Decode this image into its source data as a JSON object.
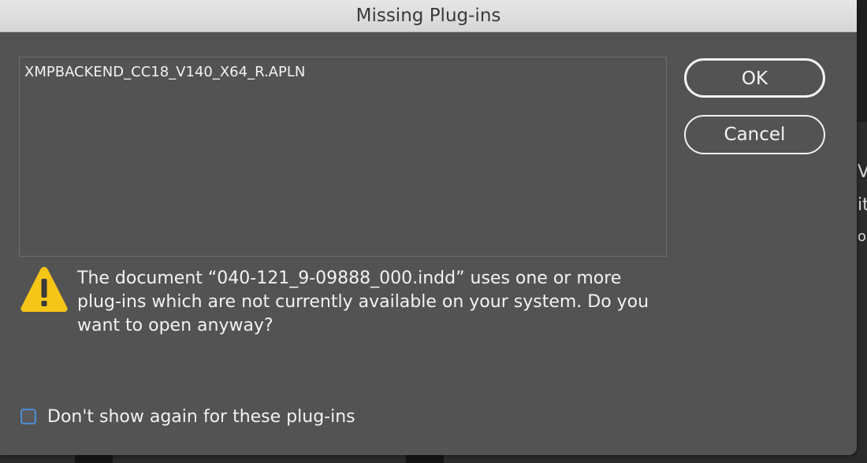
{
  "dialog": {
    "title": "Missing Plug-ins",
    "plugins": [
      "XMPBACKEND_CC18_V140_X64_R.APLN"
    ],
    "message": "The document “040-121_9-09888_000.indd” uses one or more plug-ins which are not currently available on your system. Do you want to open anyway?",
    "buttons": {
      "ok_label": "OK",
      "cancel_label": "Cancel"
    },
    "checkbox": {
      "label": "Don't show again for these plug-ins",
      "checked": false
    },
    "icon": "warning-triangle-icon"
  },
  "background": {
    "partial_glyphs": [
      "VI",
      "it",
      "o"
    ]
  },
  "colors": {
    "dialog_bg": "#535353",
    "titlebar_bg": "#dedede",
    "warning_yellow": "#f5c518",
    "checkbox_border": "#4a8fd6"
  }
}
